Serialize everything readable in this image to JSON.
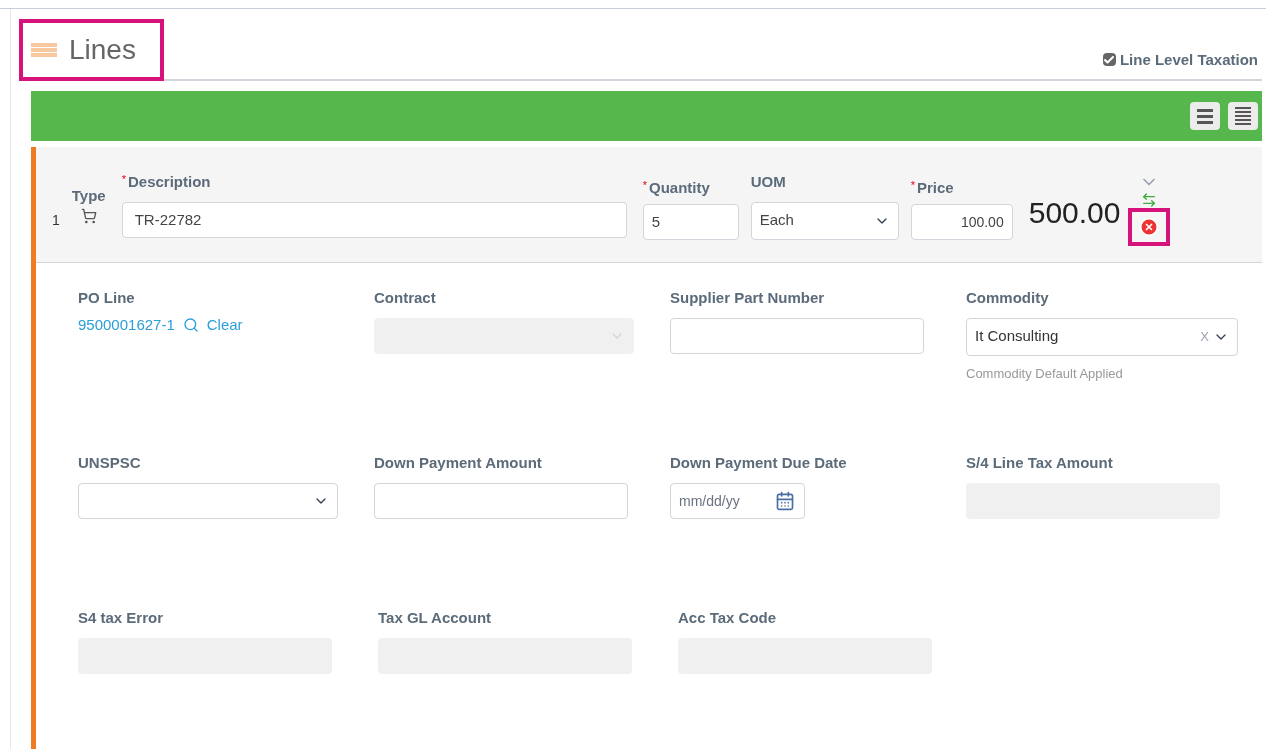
{
  "section": {
    "title": "Lines",
    "line_level_taxation": {
      "label": "Line Level Taxation",
      "checked": true
    }
  },
  "line": {
    "number": "1",
    "type_label": "Type",
    "description": {
      "required_mark": "*",
      "label": "Description",
      "value": "TR-22782"
    },
    "quantity": {
      "required_mark": "*",
      "label": "Quantity",
      "value": "5"
    },
    "uom": {
      "label": "UOM",
      "value": "Each"
    },
    "price": {
      "required_mark": "*",
      "label": "Price",
      "value": "100.00"
    },
    "total": "500.00"
  },
  "field_rows": [
    [
      {
        "kind": "link",
        "label": "PO Line",
        "value": "9500001627-1",
        "action": "Clear"
      },
      {
        "kind": "select",
        "label": "Contract",
        "disabled": true
      },
      {
        "kind": "text",
        "label": "Supplier Part Number"
      },
      {
        "kind": "combo",
        "label": "Commodity",
        "value": "It Consulting",
        "clear": "X",
        "hint": "Commodity Default Applied"
      }
    ],
    [
      {
        "kind": "select",
        "label": "UNSPSC",
        "disabled": false
      },
      {
        "kind": "text",
        "label": "Down Payment Amount"
      },
      {
        "kind": "date",
        "label": "Down Payment Due Date",
        "placeholder": "mm/dd/yy"
      },
      {
        "kind": "readonly",
        "label": "S/4 Line Tax Amount"
      }
    ],
    [
      {
        "kind": "readonly",
        "label": "S4 tax Error"
      },
      {
        "kind": "readonly",
        "label": "Tax GL Account"
      },
      {
        "kind": "readonly",
        "label": "Acc Tax Code"
      }
    ]
  ]
}
